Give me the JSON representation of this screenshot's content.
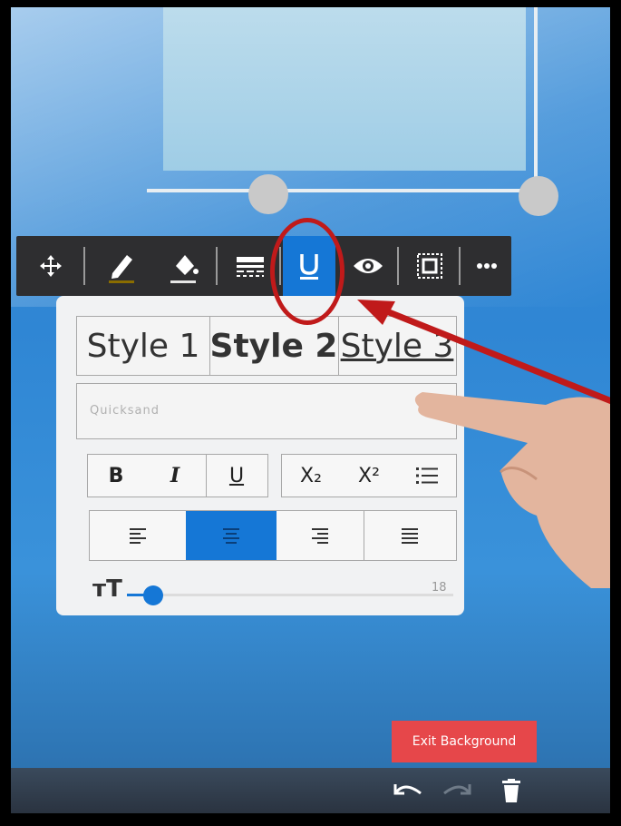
{
  "colors": {
    "accent": "#1577d6",
    "toolbar_bg": "#2e2e30",
    "exit_button": "#e6474a",
    "annotation": "#c01a1a"
  },
  "toolbar": {
    "items": [
      {
        "name": "move",
        "icon": "move-arrows-icon"
      },
      {
        "name": "pen-color",
        "icon": "pencil-icon"
      },
      {
        "name": "fill-color",
        "icon": "paint-bucket-icon"
      },
      {
        "name": "line-style",
        "icon": "line-style-icon"
      },
      {
        "name": "text-style",
        "icon": "underline-icon",
        "active": true
      },
      {
        "name": "visibility",
        "icon": "eye-icon"
      },
      {
        "name": "group",
        "icon": "select-box-icon"
      },
      {
        "name": "more",
        "icon": "more-dots-icon"
      }
    ]
  },
  "text_panel": {
    "styles": [
      "Style 1",
      "Style 2",
      "Style 3"
    ],
    "font_field": {
      "placeholder": "Quicksand"
    },
    "format_buttons": {
      "bold": "B",
      "italic": "I",
      "underline": "U",
      "subscript": "X₂",
      "superscript": "X²"
    },
    "alignment": {
      "selected": "center"
    },
    "font_size": {
      "value": "18",
      "label": "тT"
    }
  },
  "exit_background_label": "Exit Background"
}
